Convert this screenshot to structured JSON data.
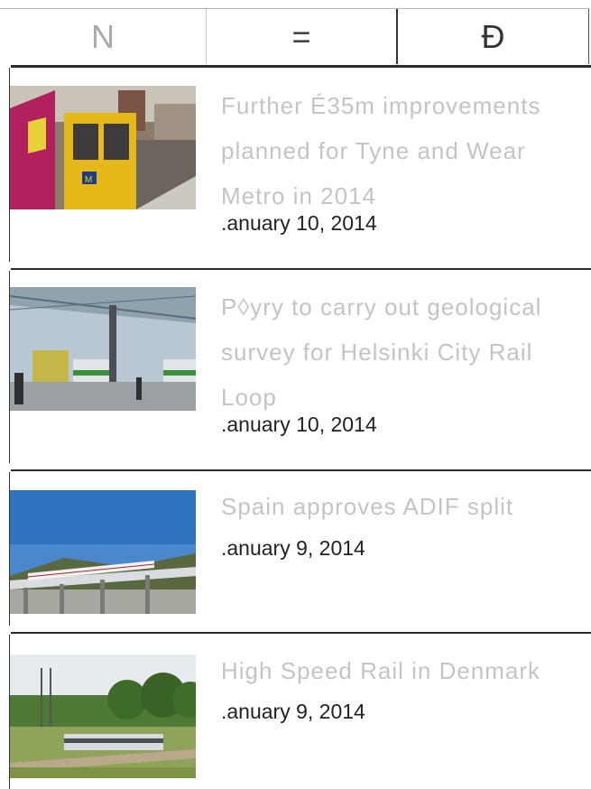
{
  "tabs": [
    {
      "label": "N"
    },
    {
      "label": "="
    },
    {
      "label": "Đ"
    }
  ],
  "articles": [
    {
      "title": "Further É35m improvements planned for Tyne and Wear Metro in 2014",
      "date": ".anuary 10, 2014",
      "image": "tyne-and-wear-metro-train-photo"
    },
    {
      "title": "P◊yry to carry out geological survey for Helsinki City Rail Loop",
      "date": ".anuary 10, 2014",
      "image": "helsinki-station-platform-render"
    },
    {
      "title": "Spain approves ADIF split",
      "date": ".anuary 9, 2014",
      "image": "high-speed-train-viaduct-photo"
    },
    {
      "title": "High Speed Rail in Denmark",
      "date": ".anuary 9, 2014",
      "image": "danish-train-countryside-photo"
    }
  ]
}
